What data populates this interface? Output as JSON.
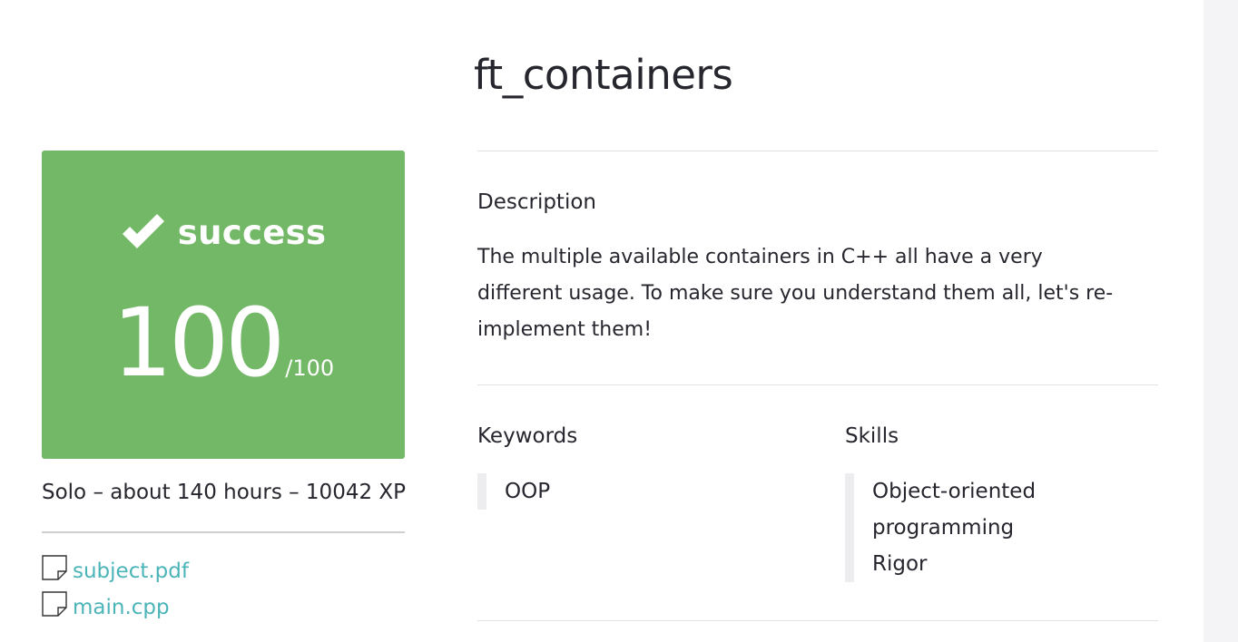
{
  "project": {
    "title": "ft_containers"
  },
  "result": {
    "status": "success",
    "score": "100",
    "max_score": "/100",
    "color": "#72b867"
  },
  "meta": {
    "summary": "Solo – about 140 hours – 10042 XP"
  },
  "attachments": [
    {
      "icon": "file-icon",
      "label": "subject.pdf"
    },
    {
      "icon": "file-icon",
      "label": "main.cpp"
    }
  ],
  "description": {
    "heading": "Description",
    "text": "The multiple available containers in C++ all have a very different usage. To make sure you understand them all, let's re-implement them!"
  },
  "keywords": {
    "heading": "Keywords",
    "items": [
      "OOP"
    ]
  },
  "skills": {
    "heading": "Skills",
    "items": [
      "Object-oriented programming",
      "Rigor"
    ]
  },
  "colors": {
    "success_green": "#72b867",
    "link_teal": "#4bb4b8",
    "text": "#26262e"
  }
}
